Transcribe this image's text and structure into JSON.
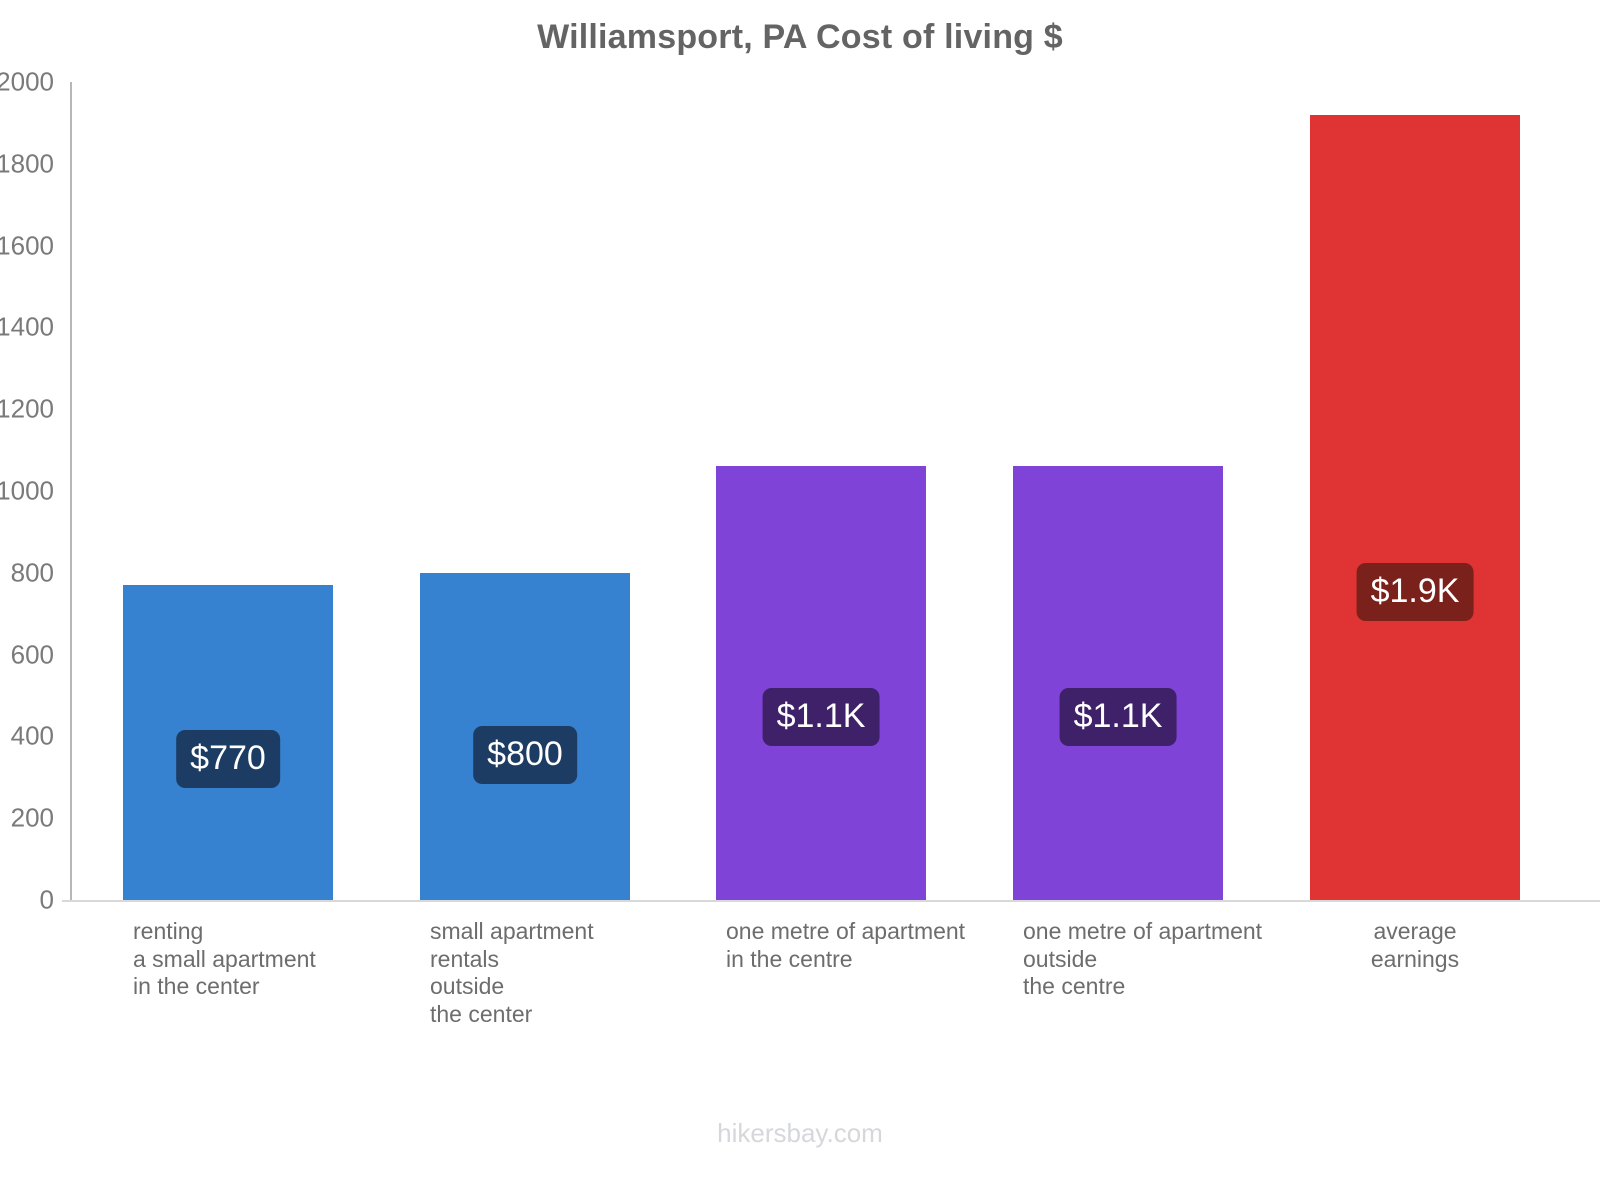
{
  "chart_data": {
    "type": "bar",
    "title": "Williamsport, PA Cost of living $",
    "xlabel": "",
    "ylabel": "",
    "ylim": [
      0,
      2000
    ],
    "yticks": [
      0,
      200,
      400,
      600,
      800,
      1000,
      1200,
      1400,
      1600,
      1800,
      2000
    ],
    "ytick_labels": [
      "0",
      "200",
      "400",
      "600",
      "800",
      "1000",
      "1200",
      "1400",
      "1600",
      "1800",
      "2000"
    ],
    "grid": false,
    "legend": "none",
    "categories": [
      "renting a small apartment in the center",
      "small apartment rentals outside the center",
      "one metre of apartment in the centre",
      "one metre of apartment outside the centre",
      "average earnings"
    ],
    "category_lines": [
      [
        "renting",
        "a small apartment",
        "in the center"
      ],
      [
        "small apartment",
        "rentals",
        "outside",
        "the center"
      ],
      [
        "one metre of apartment",
        "in the centre"
      ],
      [
        "one metre of apartment",
        "outside",
        "the centre"
      ],
      [
        "average",
        "earnings"
      ]
    ],
    "values": [
      770,
      800,
      1060,
      1060,
      1920
    ],
    "data_labels": [
      "$770",
      "$800",
      "$1.1K",
      "$1.1K",
      "$1.9K"
    ],
    "bar_colors": [
      "#3682D1",
      "#3682D1",
      "#7F44D7",
      "#7F44D7",
      "#E03434"
    ],
    "badge_colors": [
      "#1D3C63",
      "#1D3C63",
      "#3F2169",
      "#3F2169",
      "#7A211B"
    ],
    "label_alignments": [
      "left",
      "left",
      "left",
      "left",
      "center"
    ]
  },
  "footer": {
    "watermark": "hikersbay.com"
  },
  "colors": {
    "title": "#646464",
    "axis": "#b7b7b7",
    "tick_text": "#7a7a7a",
    "category_text": "#6d6d6d",
    "watermark": "#d5d7da",
    "background": "#ffffff"
  }
}
